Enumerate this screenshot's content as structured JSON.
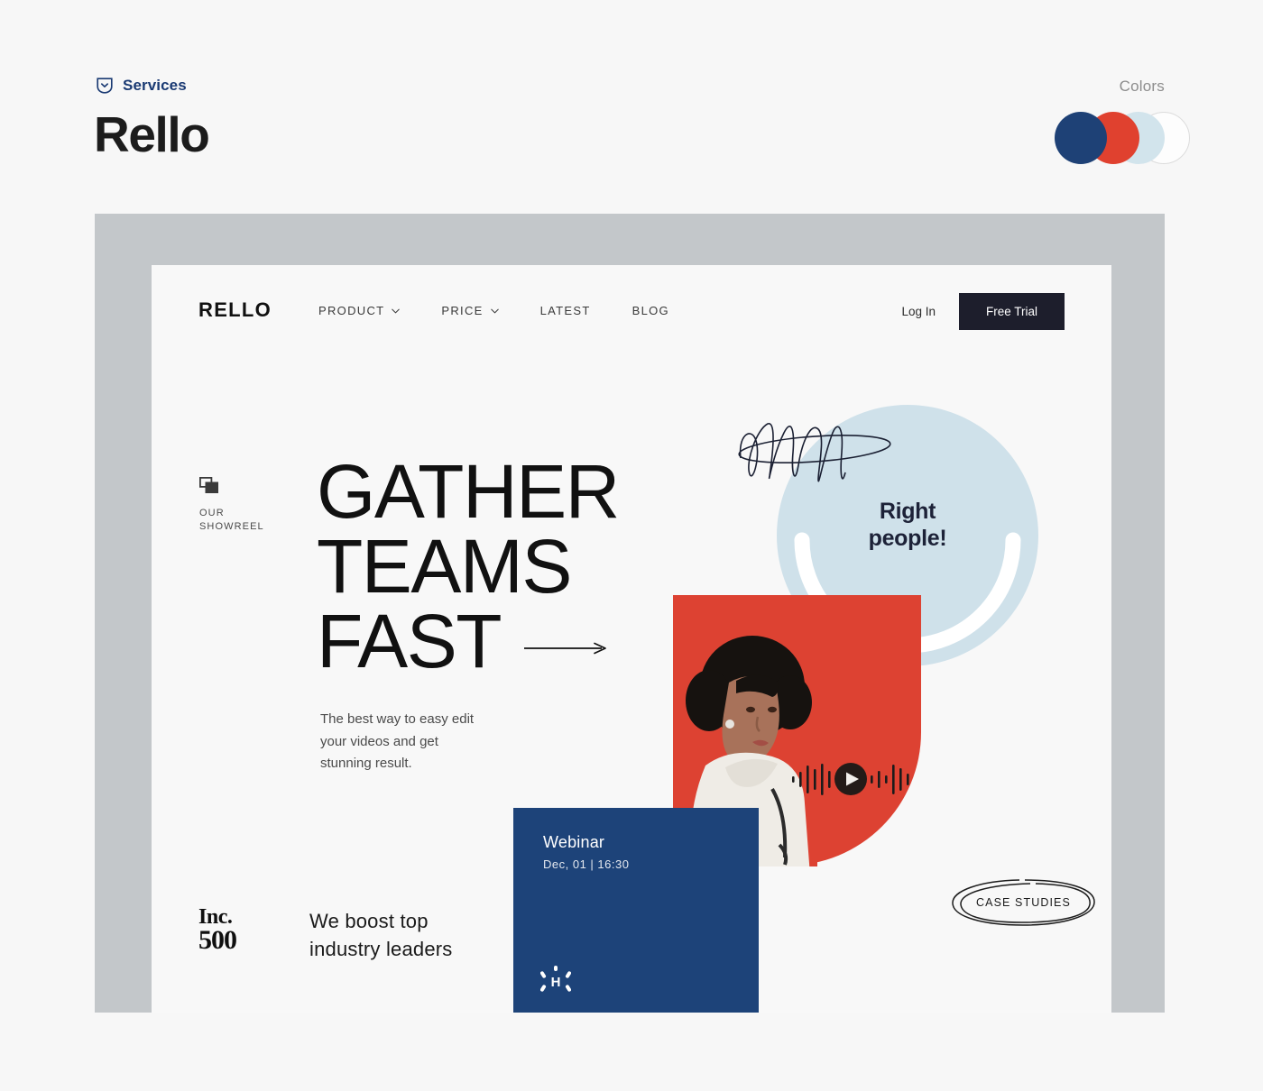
{
  "meta_header": {
    "services_label": "Services",
    "services_icon": "shield-chevron-down-icon",
    "brand_title": "Rello",
    "colors_label": "Colors",
    "swatches": [
      {
        "name": "navy",
        "hex": "#1e4176"
      },
      {
        "name": "red",
        "hex": "#e0412f"
      },
      {
        "name": "light-blue",
        "hex": "#d2e4ec"
      },
      {
        "name": "white",
        "hex": "#fdfdfd"
      }
    ]
  },
  "mockup": {
    "frame_color": "#c3c7ca",
    "page_color": "#f8f8f8",
    "nav": {
      "logo": "RELLO",
      "links": [
        {
          "label": "PRODUCT",
          "has_dropdown": true
        },
        {
          "label": "PRICE",
          "has_dropdown": true
        },
        {
          "label": "LATEST",
          "has_dropdown": false
        },
        {
          "label": "BLOG",
          "has_dropdown": false
        }
      ],
      "login_label": "Log In",
      "cta_label": "Free Trial",
      "cta_color": "#1d1e2c"
    },
    "hero": {
      "showreel_label": "OUR\nSHOWREEL",
      "showreel_icon": "windows-stack-icon",
      "headline_line1": "GATHER",
      "headline_line2": "TEAMS",
      "headline_line3": "FAST",
      "headline_arrow_icon": "arrow-right-icon",
      "sub_copy": "The best way to easy edit  your videos and get stunning result."
    },
    "boost": {
      "badge_top": "Inc.",
      "badge_bottom": "500",
      "text": "We boost top industry leaders"
    },
    "visual": {
      "blue_bubble_text_line1": "Right",
      "blue_bubble_text_line2": "people!",
      "blue_bubble_color": "#cfe1ea",
      "scribble_icon": "scribble-doodle-icon",
      "red_shape_color": "#dd4232",
      "play_icon": "play-button-icon",
      "waveform_icon": "audio-waveform-icon",
      "yellow_plus_color": "#fbcf37",
      "plus_icon": "plus-shape-icon",
      "webinar_card": {
        "title": "Webinar",
        "date": "Dec, 01  |  16:30",
        "background": "#1d4379",
        "logo_letter": "H",
        "logo_icon": "h-burst-logo-icon"
      },
      "case_studies_label": "CASE STUDIES",
      "case_studies_icon": "hand-drawn-ellipse-icon"
    }
  }
}
